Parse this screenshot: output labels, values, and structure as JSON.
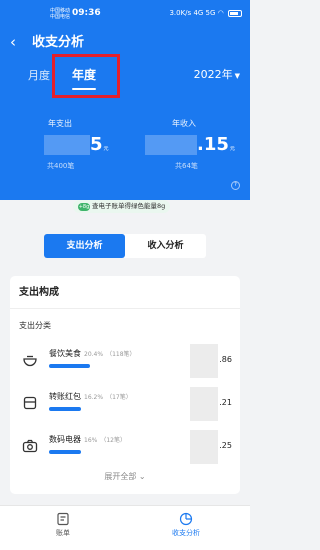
{
  "status_bar": {
    "carrier_1": "中国移动",
    "carrier_2": "中国电信",
    "time": "09:36",
    "speed": "3.0",
    "speed_unit": "K/s",
    "network": "4G 5G"
  },
  "header": {
    "title": "收支分析",
    "tabs": [
      {
        "label": "月度"
      },
      {
        "label": "年度"
      }
    ],
    "active_tab": "年度",
    "year": "2022年"
  },
  "summary": {
    "expense": {
      "label": "年支出",
      "amount_tail": "5",
      "unit": "元",
      "count": "共400笔"
    },
    "income": {
      "label": "年收入",
      "amount_tail": ".15",
      "unit": "元",
      "count": "共64笔"
    }
  },
  "promo": {
    "badge": "+8g",
    "text": "查电子账单得绿色能量8g"
  },
  "segment": {
    "expense_label": "支出分析",
    "income_label": "收入分析",
    "active": "支出分析"
  },
  "composition": {
    "title": "支出构成",
    "subtitle": "支出分类",
    "categories": [
      {
        "icon": "bowl-icon",
        "name": "餐饮美食",
        "percent": "20.4%",
        "count": "（118笔）",
        "amount_tail": ".86",
        "share": 0.204
      },
      {
        "icon": "box-icon",
        "name": "转账红包",
        "percent": "16.2%",
        "count": "（17笔）",
        "amount_tail": ".21",
        "share": 0.162
      },
      {
        "icon": "camera-icon",
        "name": "数码电器",
        "percent": "16%",
        "count": "（12笔）",
        "amount_tail": ".25",
        "share": 0.16
      }
    ],
    "expand_label": "展开全部"
  },
  "tabbar": {
    "items": [
      {
        "label": "账单"
      },
      {
        "label": "收支分析"
      }
    ],
    "active": "收支分析"
  },
  "colors": {
    "primary": "#1b79f0",
    "highlight": "#e5202a",
    "leaf": "#3fb46b"
  }
}
